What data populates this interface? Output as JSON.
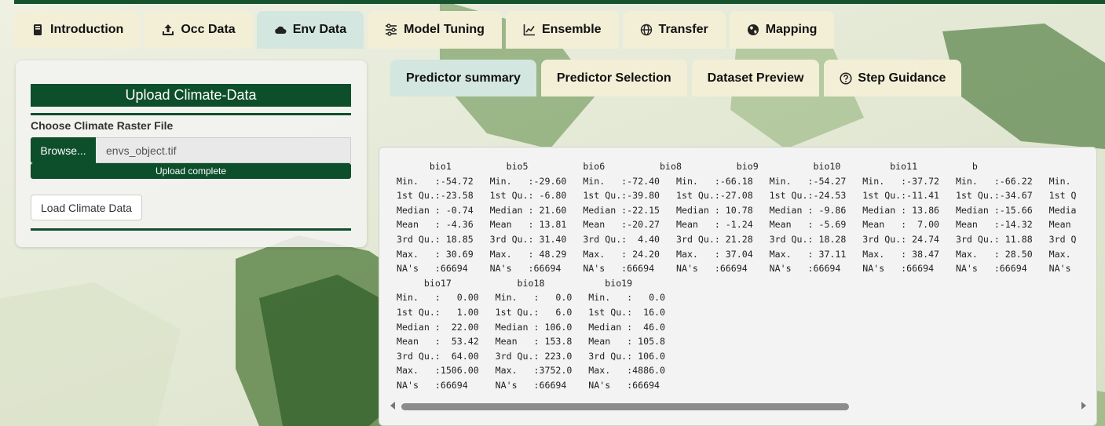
{
  "colors": {
    "accent": "#0e4f2b",
    "tab_bg": "#f2efd6",
    "tab_active_bg": "#d3e6df"
  },
  "main_tabs": [
    {
      "label": "Introduction",
      "icon": "book-icon"
    },
    {
      "label": "Occ Data",
      "icon": "upload-icon"
    },
    {
      "label": "Env Data",
      "icon": "cloud-icon",
      "active": true
    },
    {
      "label": "Model Tuning",
      "icon": "sliders-icon"
    },
    {
      "label": "Ensemble",
      "icon": "line-chart-icon"
    },
    {
      "label": "Transfer",
      "icon": "globe-icon"
    },
    {
      "label": "Mapping",
      "icon": "earth-icon"
    }
  ],
  "sidebar": {
    "title": "Upload Climate-Data",
    "file_label": "Choose Climate Raster File",
    "browse_label": "Browse...",
    "file_value": "envs_object.tif",
    "progress_text": "Upload complete",
    "progress_fraction": 1.0,
    "load_button": "Load Climate Data"
  },
  "sub_tabs": [
    {
      "label": "Predictor summary",
      "active": true
    },
    {
      "label": "Predictor Selection"
    },
    {
      "label": "Dataset Preview"
    },
    {
      "label": "Step Guidance",
      "icon": "question-circle-icon"
    }
  ],
  "summary_text": "      bio1          bio5          bio6          bio8          bio9          bio10         bio11          b\nMin.   :-54.72   Min.   :-29.60   Min.   :-72.40   Min.   :-66.18   Min.   :-54.27   Min.   :-37.72   Min.   :-66.22   Min.\n1st Qu.:-23.58   1st Qu.: -6.80   1st Qu.:-39.80   1st Qu.:-27.08   1st Qu.:-24.53   1st Qu.:-11.41   1st Qu.:-34.67   1st Q\nMedian : -0.74   Median : 21.60   Median :-22.15   Median : 10.78   Median : -9.86   Median : 13.86   Median :-15.66   Media\nMean   : -4.36   Mean   : 13.81   Mean   :-20.27   Mean   : -1.24   Mean   : -5.69   Mean   :  7.00   Mean   :-14.32   Mean\n3rd Qu.: 18.85   3rd Qu.: 31.40   3rd Qu.:  4.40   3rd Qu.: 21.28   3rd Qu.: 18.28   3rd Qu.: 24.74   3rd Qu.: 11.88   3rd Q\nMax.   : 30.69   Max.   : 48.29   Max.   : 24.20   Max.   : 37.04   Max.   : 37.11   Max.   : 38.47   Max.   : 28.50   Max.\nNA's   :66694    NA's   :66694    NA's   :66694    NA's   :66694    NA's   :66694    NA's   :66694    NA's   :66694    NA's\n     bio17            bio18           bio19\nMin.   :   0.00   Min.   :   0.0   Min.   :   0.0\n1st Qu.:   1.00   1st Qu.:   6.0   1st Qu.:  16.0\nMedian :  22.00   Median : 106.0   Median :  46.0\nMean   :  53.42   Mean   : 153.8   Mean   : 105.8\n3rd Qu.:  64.00   3rd Qu.: 223.0   3rd Qu.: 106.0\nMax.   :1506.00   Max.   :3752.0   Max.   :4886.0\nNA's   :66694     NA's   :66694    NA's   :66694"
}
